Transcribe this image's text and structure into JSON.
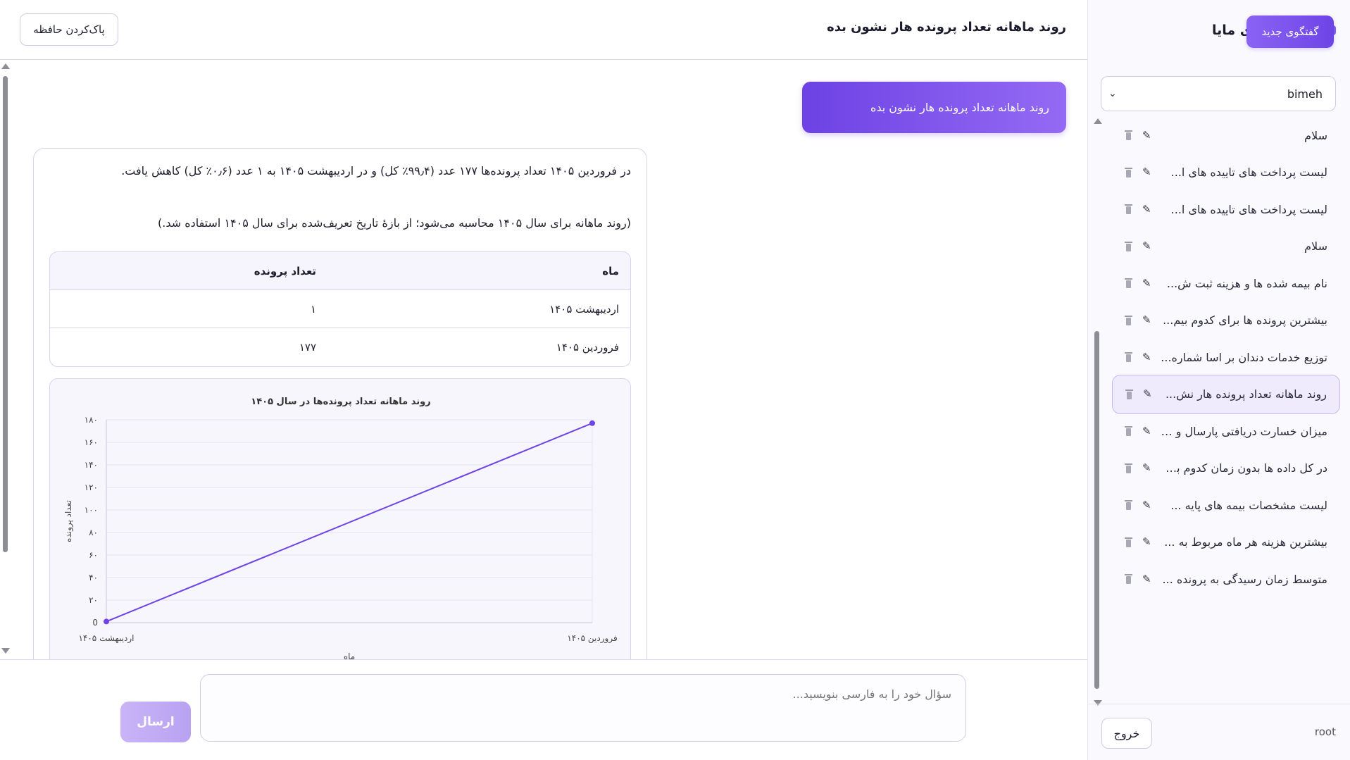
{
  "sidebar": {
    "brand_title": "هوش تجاری مایا",
    "new_chat_label": "گفتگوی جدید",
    "database_selected": "bimeh",
    "conversations": [
      {
        "label": "سلام",
        "active": false
      },
      {
        "label": "لیست پرداخت های تاییده های ا...",
        "active": false
      },
      {
        "label": "لیست پرداخت های تاییده های ا...",
        "active": false
      },
      {
        "label": "سلام",
        "active": false
      },
      {
        "label": "نام بیمه شده ها و هزینه ثبت ش...",
        "active": false
      },
      {
        "label": "بیشترین پرونده ها برای کدوم بیم...",
        "active": false
      },
      {
        "label": "توزیع خدمات دندان بر اسا شماره...",
        "active": false
      },
      {
        "label": "روند ماهانه تعداد پرونده هار نش...",
        "active": true
      },
      {
        "label": "میزان خسارت دریافتی پارسال و ا...",
        "active": false
      },
      {
        "label": "در کل داده ها بدون زمان کدوم بی...",
        "active": false
      },
      {
        "label": "لیست مشخصات بیمه های پایه ...",
        "active": false
      },
      {
        "label": "بیشترین هزینه هر ماه مربوط به ...",
        "active": false
      },
      {
        "label": "متوسط زمان رسیدگی به پرونده ...",
        "active": false
      }
    ],
    "user_name": "root",
    "logout_label": "خروج"
  },
  "header": {
    "chat_title": "روند ماهانه تعداد پرونده هار نشون بده",
    "clear_memory_label": "پاک‌کردن حافظه"
  },
  "messages": {
    "user_message": "روند ماهانه تعداد پرونده هار نشون بده",
    "bot_paragraph_1": "در فروردین ۱۴۰۵ تعداد پرونده‌ها ۱۷۷ عدد (۹۹٫۴٪ کل) و در اردیبهشت ۱۴۰۵ به ۱ عدد (۰٫۶٪ کل) کاهش یافت.",
    "bot_paragraph_2": "(روند ماهانه برای سال ۱۴۰۵ محاسبه می‌شود؛ از بازهٔ تاریخ تعریف‌شده برای سال ۱۴۰۵ استفاده شد.)",
    "table": {
      "headers": [
        "ماه",
        "تعداد پرونده"
      ],
      "rows": [
        [
          "اردیبهشت ۱۴۰۵",
          "۱"
        ],
        [
          "فروردین ۱۴۰۵",
          "۱۷۷"
        ]
      ]
    }
  },
  "chart_data": {
    "type": "line",
    "title": "روند ماهانه تعداد پرونده‌ها در سال ۱۴۰۵",
    "xlabel": "ماه",
    "ylabel": "تعداد پرونده",
    "categories": [
      "اردیبهشت ۱۴۰۵",
      "فروردین ۱۴۰۵"
    ],
    "series": [
      {
        "values": [
          1,
          177
        ]
      }
    ],
    "ylim": [
      0,
      180
    ],
    "yticks": [
      "0",
      "۲۰",
      "۴۰",
      "۶۰",
      "۸۰",
      "۱۰۰",
      "۱۲۰",
      "۱۴۰",
      "۱۶۰",
      "۱۸۰"
    ],
    "grid": true,
    "line_color": "#6e44e6"
  },
  "composer": {
    "placeholder": "سؤال خود را به فارسی بنویسید...",
    "send_label": "ارسال"
  },
  "colors": {
    "accent": "#6e44e6",
    "accent_light": "#c9b4f7",
    "active_item_bg": "#efebfc"
  }
}
